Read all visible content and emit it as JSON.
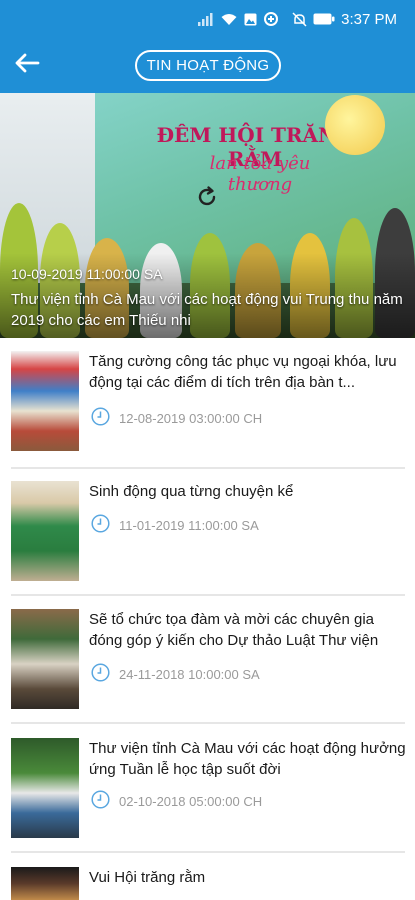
{
  "status_bar": {
    "time": "3:37 PM",
    "icons": [
      "signal-icon",
      "wifi-icon",
      "image-icon",
      "data-saver-icon",
      "mute-icon",
      "battery-icon"
    ]
  },
  "header": {
    "title": "TIN HOẠT ĐỘNG",
    "back_icon": "arrow-left-icon",
    "color": "#1f8fd6"
  },
  "hero": {
    "banner_title": "ĐÊM HỘI TRĂNG RẰM",
    "banner_subtitle": "lan tỏa yêu thương",
    "date": "10-09-2019 11:00:00 SA",
    "title": "Thư viện tỉnh Cà Mau với các hoạt động vui Trung thu năm 2019 cho các em Thiếu nhi",
    "refresh_icon": "refresh-icon"
  },
  "news": [
    {
      "title": "Tăng cường công tác phục vụ ngoại khóa, lưu động  tại các điểm di tích trên địa bàn t...",
      "date": "12-08-2019 03:00:00 CH"
    },
    {
      "title": "Sinh động qua từng chuyện kể",
      "date": "11-01-2019 11:00:00 SA"
    },
    {
      "title": "Sẽ tổ chức tọa đàm và mời các chuyên gia đóng góp ý kiến cho Dự thảo Luật Thư viện",
      "date": "24-11-2018 10:00:00 SA"
    },
    {
      "title": "Thư viện tỉnh Cà Mau với các hoạt động hưởng ứng Tuần lễ học tập suốt đời",
      "date": "02-10-2018 05:00:00 CH"
    },
    {
      "title": "Vui Hội trăng rằm",
      "date": ""
    }
  ],
  "colors": {
    "accent": "#1f8fd6",
    "date_icon": "#5aa7e0",
    "date_text": "#9a9a9a"
  }
}
